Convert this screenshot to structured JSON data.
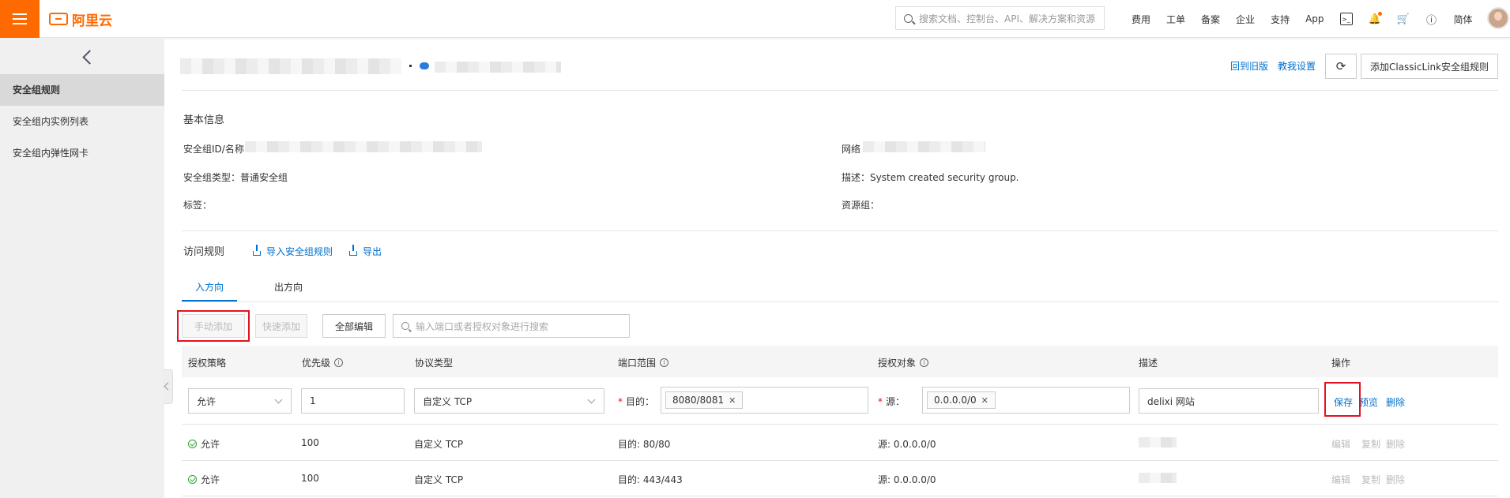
{
  "topbar": {
    "logo_text": "阿里云",
    "search_placeholder": "搜索文档、控制台、API、解决方案和资源",
    "nav": [
      "费用",
      "工单",
      "备案",
      "企业",
      "支持",
      "App"
    ],
    "lang": "简体"
  },
  "sidebar": {
    "items": [
      {
        "label": "安全组规则"
      },
      {
        "label": "安全组内实例列表"
      },
      {
        "label": "安全组内弹性网卡"
      }
    ]
  },
  "header": {
    "back_old": "回到旧版",
    "tutorial": "教我设置",
    "add_classiclink": "添加ClassicLink安全组规则"
  },
  "basic": {
    "title": "基本信息",
    "id_label": "安全组ID/名称",
    "network_label": "网络",
    "type_label": "安全组类型：",
    "type_value": "普通安全组",
    "desc_label": "描述：",
    "desc_value": "System created security group.",
    "tags_label": "标签：",
    "resgroup_label": "资源组："
  },
  "rules": {
    "title": "访问规则",
    "import": "导入安全组规则",
    "export": "导出",
    "tabs": [
      "入方向",
      "出方向"
    ],
    "toolbar": {
      "manual_add": "手动添加",
      "quick_add": "快速添加",
      "edit_all": "全部编辑",
      "search_placeholder": "输入端口或者授权对象进行搜索"
    },
    "columns": [
      "授权策略",
      "优先级",
      "协议类型",
      "端口范围",
      "授权对象",
      "描述",
      "操作"
    ],
    "edit_row": {
      "policy": "允许",
      "priority": "1",
      "protocol": "自定义 TCP",
      "dest_label": "目的：",
      "port_tag": "8080/8081",
      "src_label": "源：",
      "src_tag": "0.0.0.0/0",
      "description": "delixi 网站",
      "save": "保存",
      "preview": "预览",
      "delete": "删除"
    },
    "rows": [
      {
        "policy": "允许",
        "priority": "100",
        "protocol": "自定义 TCP",
        "port": "目的: 80/80",
        "source": "源: 0.0.0.0/0"
      },
      {
        "policy": "允许",
        "priority": "100",
        "protocol": "自定义 TCP",
        "port": "目的: 443/443",
        "source": "源: 0.0.0.0/0"
      }
    ],
    "row_actions": [
      "编辑",
      "复制",
      "删除"
    ]
  }
}
